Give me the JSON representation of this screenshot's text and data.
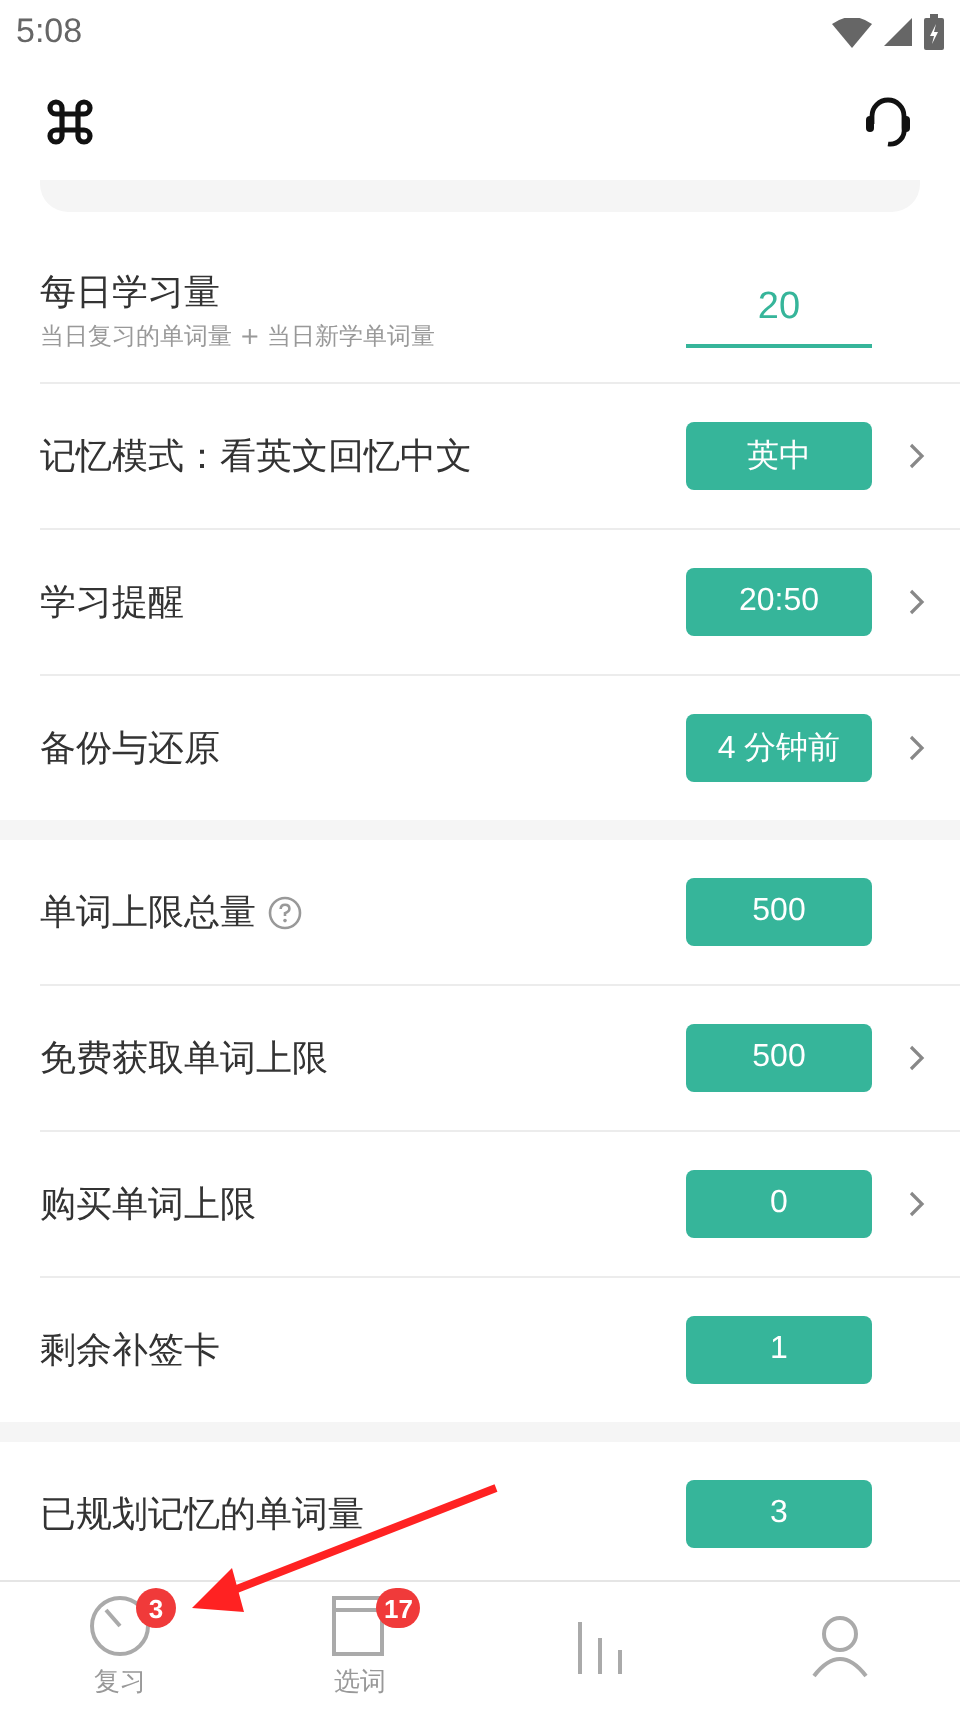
{
  "status_bar": {
    "time": "5:08"
  },
  "sections": [
    {
      "rows": [
        {
          "kind": "input",
          "label": "每日学习量",
          "subtitle": "当日复习的单词量 + 当日新学单词量",
          "value": "20",
          "chevron": false,
          "help": false
        },
        {
          "kind": "pill",
          "label": "记忆模式：看英文回忆中文",
          "value": "英中",
          "chevron": true,
          "help": false
        },
        {
          "kind": "pill",
          "label": "学习提醒",
          "value": "20:50",
          "chevron": true,
          "help": false
        },
        {
          "kind": "pill",
          "label": "备份与还原",
          "value": "4 分钟前",
          "chevron": true,
          "help": false
        }
      ]
    },
    {
      "rows": [
        {
          "kind": "pill",
          "label": "单词上限总量",
          "value": "500",
          "chevron": false,
          "help": true
        },
        {
          "kind": "pill",
          "label": "免费获取单词上限",
          "value": "500",
          "chevron": true,
          "help": false
        },
        {
          "kind": "pill",
          "label": "购买单词上限",
          "value": "0",
          "chevron": true,
          "help": false
        },
        {
          "kind": "pill",
          "label": "剩余补签卡",
          "value": "1",
          "chevron": false,
          "help": false
        }
      ]
    },
    {
      "rows": [
        {
          "kind": "pill",
          "label": "已规划记忆的单词量",
          "value": "3",
          "chevron": false,
          "help": false
        }
      ]
    }
  ],
  "bottom_nav": [
    {
      "kind": "gauge",
      "label": "复习",
      "badge": "3"
    },
    {
      "kind": "book",
      "label": "选词",
      "badge": "17"
    },
    {
      "kind": "chart"
    },
    {
      "kind": "person"
    }
  ]
}
